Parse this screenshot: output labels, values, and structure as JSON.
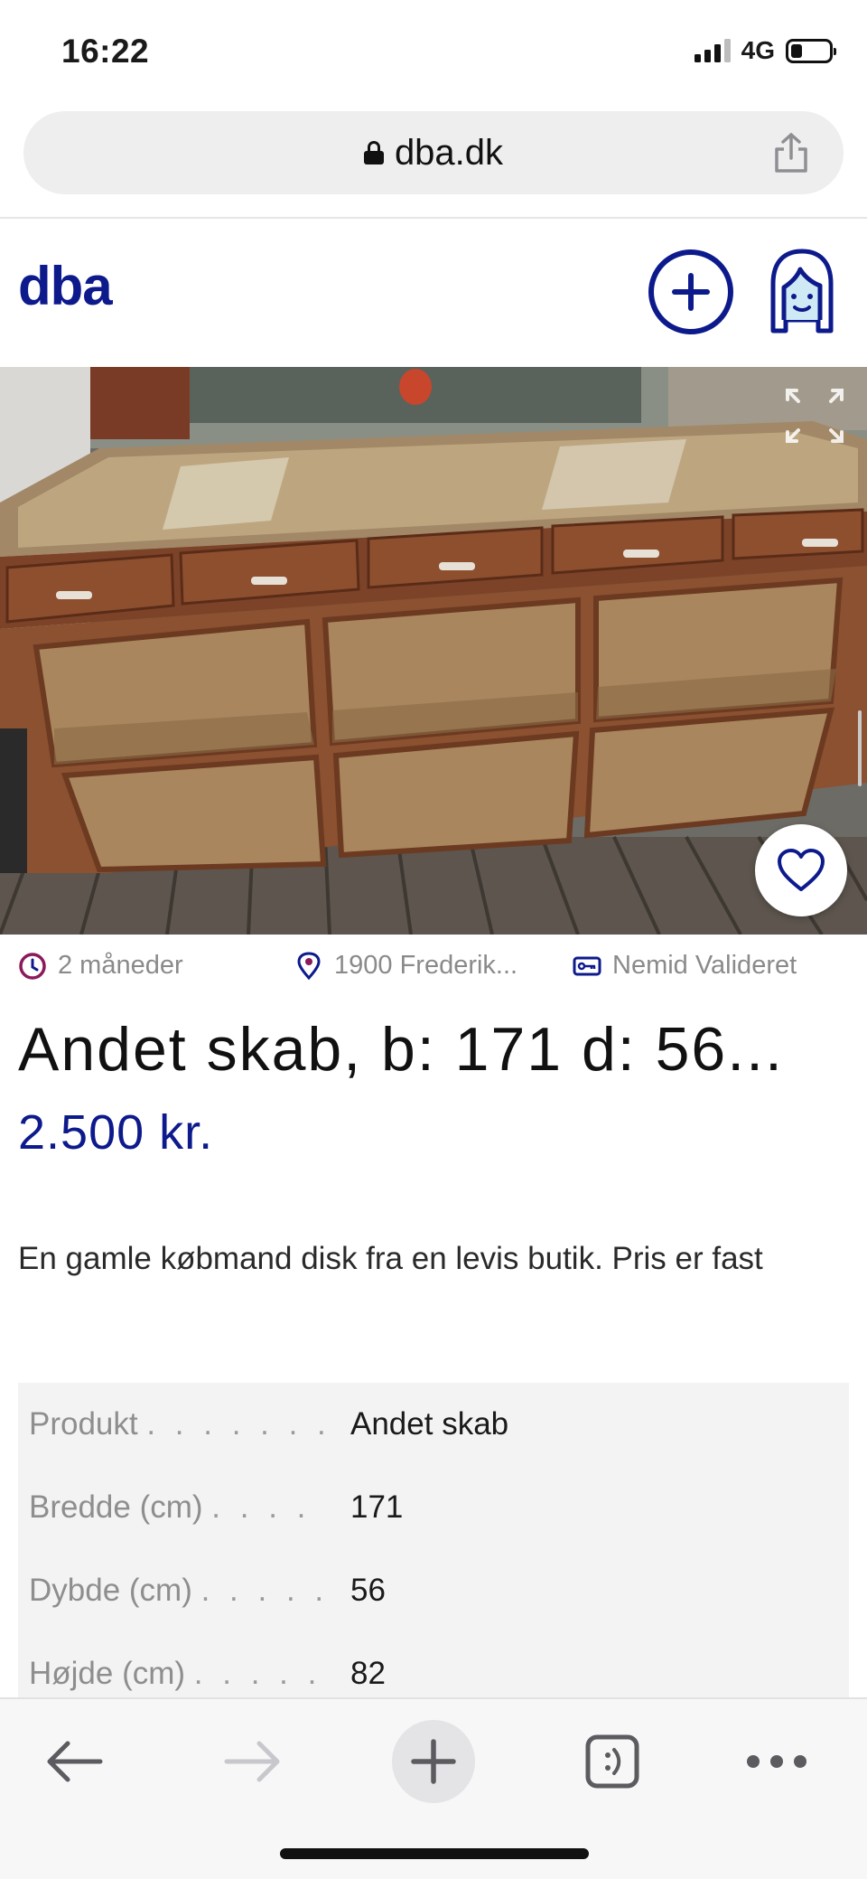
{
  "status_bar": {
    "time": "16:22",
    "network": "4G"
  },
  "browser": {
    "url": "dba.dk"
  },
  "site": {
    "logo": "dba"
  },
  "listing": {
    "age": "2 måneder",
    "location": "1900 Frederik...",
    "verified": "Nemid Valideret",
    "title": "Andet skab, b: 171 d: 56...",
    "price": "2.500 kr.",
    "description": "En gamle købmand disk fra en levis butik. Pris er fast",
    "specs": [
      {
        "label": "Produkt",
        "dots": ". . . . . . .",
        "value": "Andet skab"
      },
      {
        "label": "Bredde (cm)",
        "dots": ". . . .",
        "value": "171"
      },
      {
        "label": "Dybde (cm)",
        "dots": ". . . . .",
        "value": "56"
      },
      {
        "label": "Højde (cm)",
        "dots": ". . . . .",
        "value": "82"
      }
    ]
  },
  "colors": {
    "brand": "#0d1a8c",
    "accent_pin": "#8b1a5a"
  },
  "icons": [
    "lock-icon",
    "share-icon",
    "add-listing-icon",
    "profile-avatar-icon",
    "expand-icon",
    "heart-icon",
    "clock-icon",
    "location-pin-icon",
    "id-card-icon",
    "back-arrow-icon",
    "forward-arrow-icon",
    "new-tab-icon",
    "tabs-icon",
    "more-icon"
  ]
}
